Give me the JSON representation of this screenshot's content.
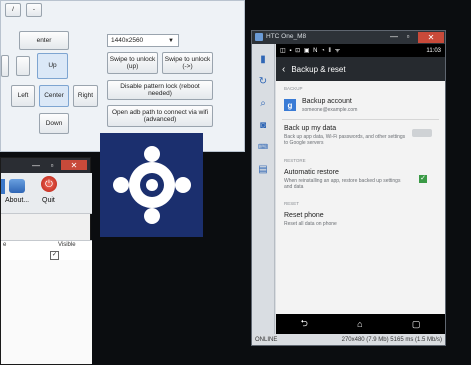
{
  "control": {
    "top_buttons": [
      "/",
      "-"
    ],
    "enter_label": "enter",
    "resolution_value": "1440x2560",
    "dpad": {
      "up": "Up",
      "left": "Left",
      "center": "Center",
      "right": "Right",
      "down": "Down"
    },
    "swipe_up": "Swipe to unlock (up)",
    "swipe_right": "Swipe to unlock (->)",
    "disable_pattern": "Disable pattern lock (reboot needed)",
    "open_adb": "Open adb path to connect via wifi (advanced)"
  },
  "window2": {
    "about_label": "About...",
    "quit_label": "Quit",
    "col_1": "e",
    "col_2": "Visible",
    "check_mark": "✓"
  },
  "emulator": {
    "title": "HTC One_M8",
    "status_time": "11:03",
    "status_icons": "◫ ▪ ⊡ ▣ N ◔ ⦀ ᯤ",
    "screen_title": "Backup & reset",
    "backup_section": "BACKUP",
    "backup_account_title": "Backup account",
    "backup_account_email": "someone@example.com",
    "backup_data_title": "Back up my data",
    "backup_data_desc": "Back up app data, Wi-Fi passwords, and other settings to Google servers",
    "restore_section": "RESTORE",
    "auto_restore_title": "Automatic restore",
    "auto_restore_desc": "When reinstalling an app, restore backed up settings and data",
    "reset_section": "RESET",
    "reset_phone_title": "Reset phone",
    "reset_phone_desc": "Reset all data on phone",
    "footer_status": "ONLINE",
    "footer_info": "270x480 (7.9 Mb)   5165 ms (1.5 Mb/s)",
    "nav_back": "⮌",
    "nav_home": "⌂",
    "nav_recent": "▢"
  },
  "colors": {
    "logo_bg": "#1b2f6e",
    "accent_green": "#3a9a46",
    "close_red": "#c84a3a"
  }
}
